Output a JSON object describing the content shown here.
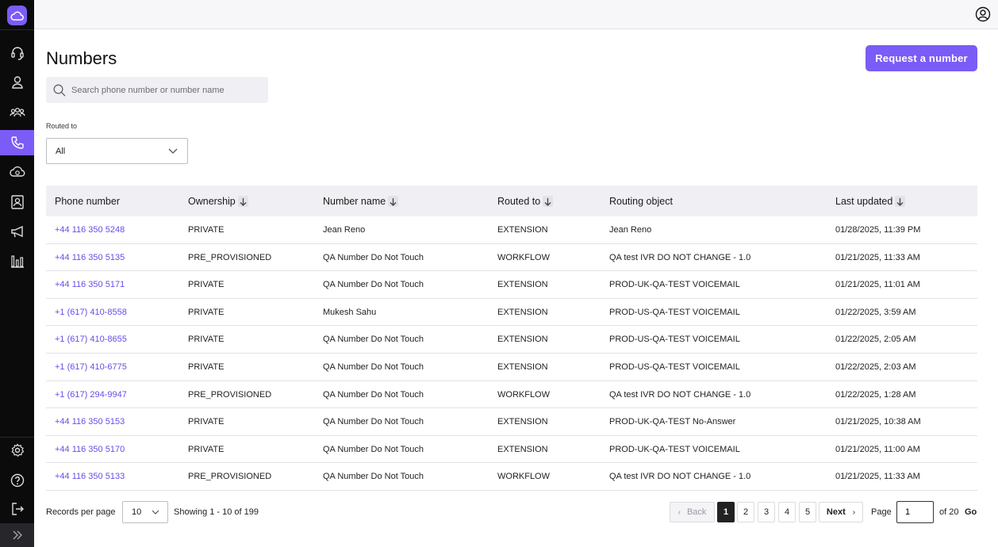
{
  "colors": {
    "accent": "#7b5cf6",
    "link": "#6a4be8",
    "sidebar_bg": "#0b0b0c"
  },
  "sidebar": {
    "logo_icon": "cloud-icon",
    "items": [
      {
        "icon": "headset-icon"
      },
      {
        "icon": "user-icon"
      },
      {
        "icon": "users-group-icon"
      },
      {
        "icon": "phone-icon",
        "active": true
      },
      {
        "icon": "cloud-sync-icon"
      },
      {
        "icon": "contact-card-icon"
      },
      {
        "icon": "megaphone-icon"
      },
      {
        "icon": "analytics-bars-icon"
      }
    ],
    "bottom_items": [
      {
        "icon": "gear-icon"
      },
      {
        "icon": "help-icon"
      },
      {
        "icon": "logout-icon"
      }
    ],
    "expand_icon": "double-chevron-right-icon"
  },
  "header": {
    "user_icon": "account-circle-icon"
  },
  "page": {
    "title": "Numbers",
    "request_button": "Request a number",
    "search_placeholder": "Search phone number or number name",
    "filter": {
      "label": "Routed to",
      "value": "All"
    }
  },
  "table": {
    "columns": [
      {
        "label": "Phone number",
        "sortable": false
      },
      {
        "label": "Ownership",
        "sortable": true
      },
      {
        "label": "Number name",
        "sortable": true
      },
      {
        "label": "Routed to",
        "sortable": true
      },
      {
        "label": "Routing object",
        "sortable": false
      },
      {
        "label": "Last updated",
        "sortable": true
      }
    ],
    "rows": [
      [
        "+44 116 350 5248",
        "PRIVATE",
        "Jean Reno",
        "EXTENSION",
        "Jean Reno",
        "01/28/2025, 11:39 PM"
      ],
      [
        "+44 116 350 5135",
        "PRE_PROVISIONED",
        "QA Number Do Not Touch",
        "WORKFLOW",
        "QA test IVR DO NOT CHANGE - 1.0",
        "01/21/2025, 11:33 AM"
      ],
      [
        "+44 116 350 5171",
        "PRIVATE",
        "QA Number Do Not Touch",
        "EXTENSION",
        "PROD-UK-QA-TEST VOICEMAIL",
        "01/21/2025, 11:01 AM"
      ],
      [
        "+1 (617) 410-8558",
        "PRIVATE",
        "Mukesh Sahu",
        "EXTENSION",
        "PROD-US-QA-TEST VOICEMAIL",
        "01/22/2025, 3:59 AM"
      ],
      [
        "+1 (617) 410-8655",
        "PRIVATE",
        "QA Number Do Not Touch",
        "EXTENSION",
        "PROD-US-QA-TEST VOICEMAIL",
        "01/22/2025, 2:05 AM"
      ],
      [
        "+1 (617) 410-6775",
        "PRIVATE",
        "QA Number Do Not Touch",
        "EXTENSION",
        "PROD-US-QA-TEST VOICEMAIL",
        "01/22/2025, 2:03 AM"
      ],
      [
        "+1 (617) 294-9947",
        "PRE_PROVISIONED",
        "QA Number Do Not Touch",
        "WORKFLOW",
        "QA test IVR DO NOT CHANGE - 1.0",
        "01/22/2025, 1:28 AM"
      ],
      [
        "+44 116 350 5153",
        "PRIVATE",
        "QA Number Do Not Touch",
        "EXTENSION",
        "PROD-UK-QA-TEST No-Answer",
        "01/21/2025, 10:38 AM"
      ],
      [
        "+44 116 350 5170",
        "PRIVATE",
        "QA Number Do Not Touch",
        "EXTENSION",
        "PROD-UK-QA-TEST VOICEMAIL",
        "01/21/2025, 11:00 AM"
      ],
      [
        "+44 116 350 5133",
        "PRE_PROVISIONED",
        "QA Number Do Not Touch",
        "WORKFLOW",
        "QA test IVR DO NOT CHANGE - 1.0",
        "01/21/2025, 11:33 AM"
      ]
    ]
  },
  "footer": {
    "records_label": "Records per page",
    "records_value": "10",
    "showing": "Showing 1 - 10 of 199",
    "back": "Back",
    "pages": [
      "1",
      "2",
      "3",
      "4",
      "5"
    ],
    "current_page": "1",
    "next": "Next",
    "page_label": "Page",
    "page_input": "1",
    "of_label": "of 20",
    "go": "Go"
  }
}
